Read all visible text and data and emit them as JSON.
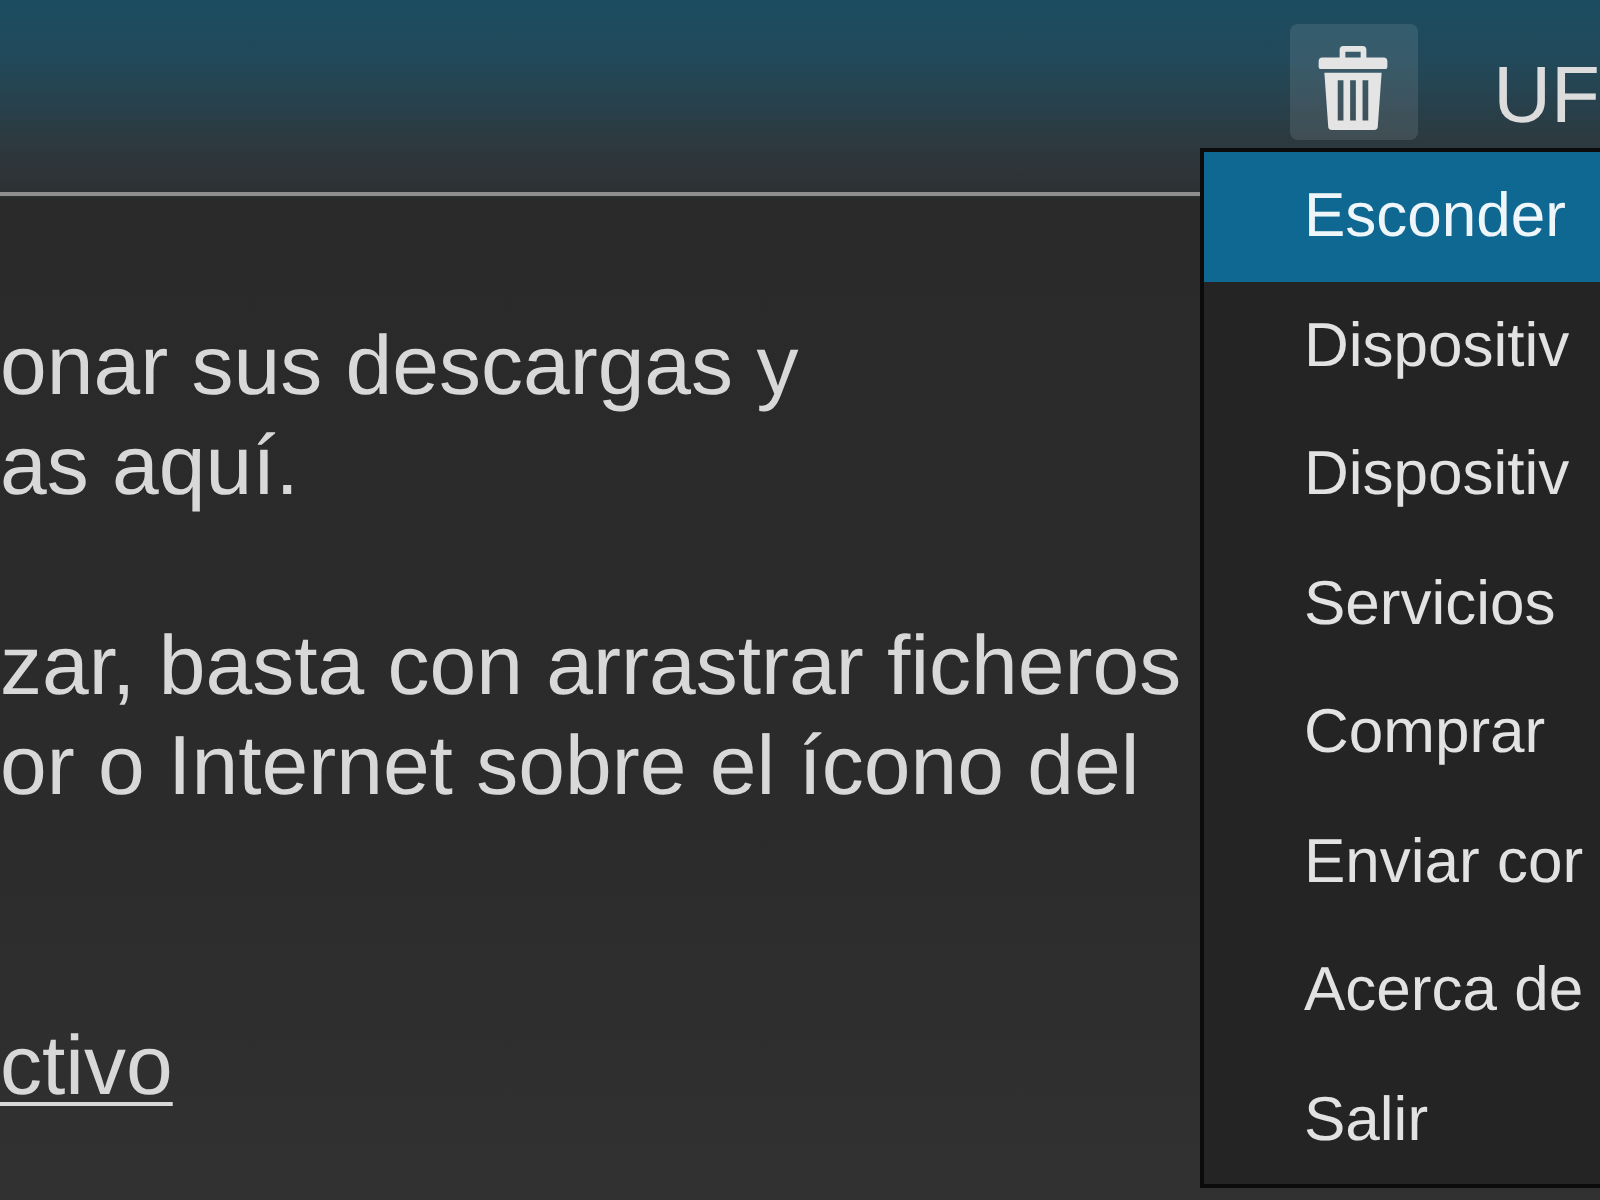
{
  "header": {
    "label": "UF"
  },
  "content": {
    "paragraphs": [
      {
        "lines": [
          "onar sus descargas y",
          "as aquí."
        ]
      },
      {
        "lines": [
          "zar, basta con arrastrar ficheros",
          "or o Internet sobre el ícono del"
        ]
      }
    ],
    "link": "ctivo"
  },
  "menu": {
    "items": [
      {
        "label": "Esconder",
        "selected": true
      },
      {
        "label": "Dispositiv",
        "selected": false
      },
      {
        "label": "Dispositiv",
        "selected": false
      },
      {
        "label": "Servicios",
        "selected": false
      },
      {
        "label": "Comprar",
        "selected": false
      },
      {
        "label": "Enviar cor",
        "selected": false
      },
      {
        "label": "Acerca de",
        "selected": false
      },
      {
        "label": "Salir",
        "selected": false
      }
    ]
  }
}
